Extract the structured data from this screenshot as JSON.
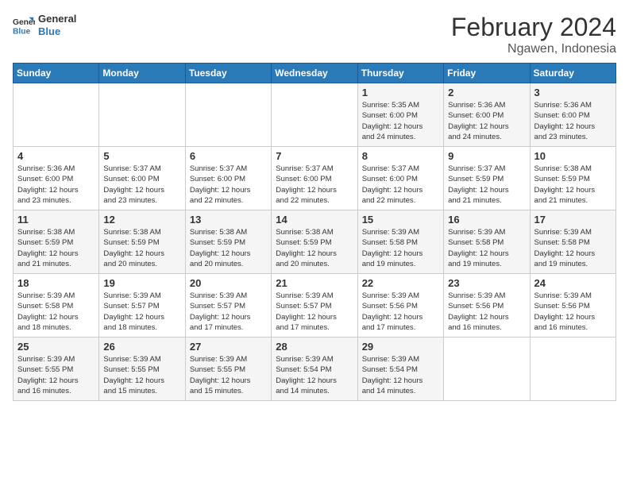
{
  "logo": {
    "line1": "General",
    "line2": "Blue"
  },
  "header": {
    "month": "February 2024",
    "location": "Ngawen, Indonesia"
  },
  "days_of_week": [
    "Sunday",
    "Monday",
    "Tuesday",
    "Wednesday",
    "Thursday",
    "Friday",
    "Saturday"
  ],
  "weeks": [
    [
      {
        "day": "",
        "info": ""
      },
      {
        "day": "",
        "info": ""
      },
      {
        "day": "",
        "info": ""
      },
      {
        "day": "",
        "info": ""
      },
      {
        "day": "1",
        "info": "Sunrise: 5:35 AM\nSunset: 6:00 PM\nDaylight: 12 hours\nand 24 minutes."
      },
      {
        "day": "2",
        "info": "Sunrise: 5:36 AM\nSunset: 6:00 PM\nDaylight: 12 hours\nand 24 minutes."
      },
      {
        "day": "3",
        "info": "Sunrise: 5:36 AM\nSunset: 6:00 PM\nDaylight: 12 hours\nand 23 minutes."
      }
    ],
    [
      {
        "day": "4",
        "info": "Sunrise: 5:36 AM\nSunset: 6:00 PM\nDaylight: 12 hours\nand 23 minutes."
      },
      {
        "day": "5",
        "info": "Sunrise: 5:37 AM\nSunset: 6:00 PM\nDaylight: 12 hours\nand 23 minutes."
      },
      {
        "day": "6",
        "info": "Sunrise: 5:37 AM\nSunset: 6:00 PM\nDaylight: 12 hours\nand 22 minutes."
      },
      {
        "day": "7",
        "info": "Sunrise: 5:37 AM\nSunset: 6:00 PM\nDaylight: 12 hours\nand 22 minutes."
      },
      {
        "day": "8",
        "info": "Sunrise: 5:37 AM\nSunset: 6:00 PM\nDaylight: 12 hours\nand 22 minutes."
      },
      {
        "day": "9",
        "info": "Sunrise: 5:37 AM\nSunset: 5:59 PM\nDaylight: 12 hours\nand 21 minutes."
      },
      {
        "day": "10",
        "info": "Sunrise: 5:38 AM\nSunset: 5:59 PM\nDaylight: 12 hours\nand 21 minutes."
      }
    ],
    [
      {
        "day": "11",
        "info": "Sunrise: 5:38 AM\nSunset: 5:59 PM\nDaylight: 12 hours\nand 21 minutes."
      },
      {
        "day": "12",
        "info": "Sunrise: 5:38 AM\nSunset: 5:59 PM\nDaylight: 12 hours\nand 20 minutes."
      },
      {
        "day": "13",
        "info": "Sunrise: 5:38 AM\nSunset: 5:59 PM\nDaylight: 12 hours\nand 20 minutes."
      },
      {
        "day": "14",
        "info": "Sunrise: 5:38 AM\nSunset: 5:59 PM\nDaylight: 12 hours\nand 20 minutes."
      },
      {
        "day": "15",
        "info": "Sunrise: 5:39 AM\nSunset: 5:58 PM\nDaylight: 12 hours\nand 19 minutes."
      },
      {
        "day": "16",
        "info": "Sunrise: 5:39 AM\nSunset: 5:58 PM\nDaylight: 12 hours\nand 19 minutes."
      },
      {
        "day": "17",
        "info": "Sunrise: 5:39 AM\nSunset: 5:58 PM\nDaylight: 12 hours\nand 19 minutes."
      }
    ],
    [
      {
        "day": "18",
        "info": "Sunrise: 5:39 AM\nSunset: 5:58 PM\nDaylight: 12 hours\nand 18 minutes."
      },
      {
        "day": "19",
        "info": "Sunrise: 5:39 AM\nSunset: 5:57 PM\nDaylight: 12 hours\nand 18 minutes."
      },
      {
        "day": "20",
        "info": "Sunrise: 5:39 AM\nSunset: 5:57 PM\nDaylight: 12 hours\nand 17 minutes."
      },
      {
        "day": "21",
        "info": "Sunrise: 5:39 AM\nSunset: 5:57 PM\nDaylight: 12 hours\nand 17 minutes."
      },
      {
        "day": "22",
        "info": "Sunrise: 5:39 AM\nSunset: 5:56 PM\nDaylight: 12 hours\nand 17 minutes."
      },
      {
        "day": "23",
        "info": "Sunrise: 5:39 AM\nSunset: 5:56 PM\nDaylight: 12 hours\nand 16 minutes."
      },
      {
        "day": "24",
        "info": "Sunrise: 5:39 AM\nSunset: 5:56 PM\nDaylight: 12 hours\nand 16 minutes."
      }
    ],
    [
      {
        "day": "25",
        "info": "Sunrise: 5:39 AM\nSunset: 5:55 PM\nDaylight: 12 hours\nand 16 minutes."
      },
      {
        "day": "26",
        "info": "Sunrise: 5:39 AM\nSunset: 5:55 PM\nDaylight: 12 hours\nand 15 minutes."
      },
      {
        "day": "27",
        "info": "Sunrise: 5:39 AM\nSunset: 5:55 PM\nDaylight: 12 hours\nand 15 minutes."
      },
      {
        "day": "28",
        "info": "Sunrise: 5:39 AM\nSunset: 5:54 PM\nDaylight: 12 hours\nand 14 minutes."
      },
      {
        "day": "29",
        "info": "Sunrise: 5:39 AM\nSunset: 5:54 PM\nDaylight: 12 hours\nand 14 minutes."
      },
      {
        "day": "",
        "info": ""
      },
      {
        "day": "",
        "info": ""
      }
    ]
  ]
}
